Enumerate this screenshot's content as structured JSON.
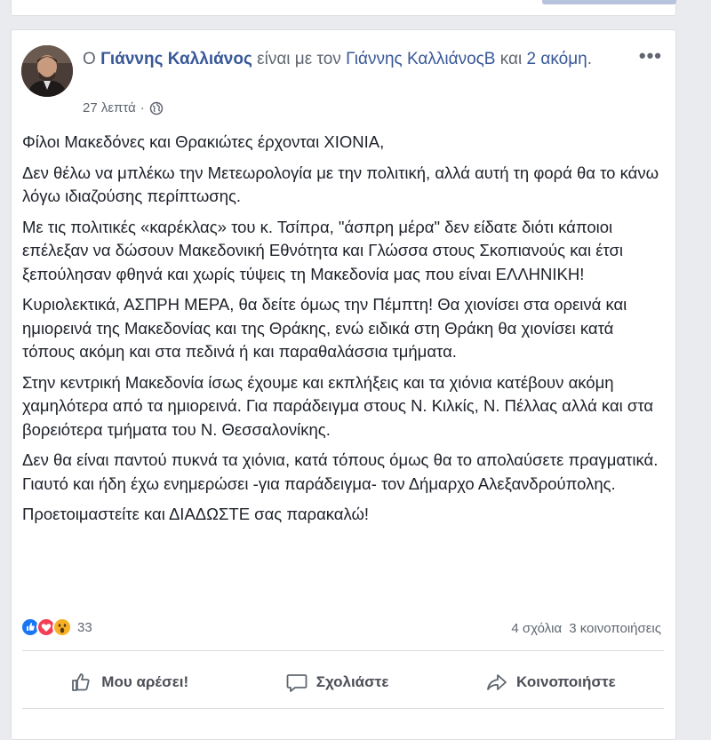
{
  "post": {
    "header": {
      "article": "Ο",
      "author": "Γιάννης Καλλιάνος",
      "with_text": "είναι με τον",
      "tagged": "Γιάννης ΚαλλιάνοςΒ",
      "and_text": "και",
      "others": "2 ακόμη",
      "period": "."
    },
    "timestamp": "27 λεπτά",
    "separator": "·",
    "privacy_icon": "globe-icon",
    "paragraphs": [
      "Φίλοι Μακεδόνες και Θρακιώτες έρχονται ΧΙΟΝΙΑ,",
      "Δεν θέλω να μπλέκω την Μετεωρολογία με την πολιτική, αλλά αυτή τη φορά θα το κάνω λόγω ιδιαζούσης περίπτωσης.",
      "Με τις πολιτικές «καρέκλας» του κ. Τσίπρα, \"άσπρη μέρα\" δεν είδατε διότι κάποιοι επέλεξαν να δώσουν Μακεδονική Εθνότητα και Γλώσσα στους Σκοπιανούς και έτσι ξεπούλησαν φθηνά και χωρίς τύψεις τη Μακεδονία μας που είναι ΕΛΛΗΝΙΚΗ!",
      "Κυριολεκτικά, ΑΣΠΡΗ ΜΕΡΑ, θα δείτε όμως την Πέμπτη! Θα χιονίσει στα ορεινά και ημιορεινά της Μακεδονίας και της Θράκης, ενώ ειδικά στη Θράκη θα χιονίσει κατά τόπους ακόμη και στα πεδινά ή και παραθαλάσσια τμήματα.",
      "Στην κεντρική Μακεδονία ίσως έχουμε και εκπλήξεις και τα χιόνια κατέβουν ακόμη χαμηλότερα από τα ημιορεινά. Για παράδειγμα στους Ν. Κιλκίς, Ν. Πέλλας αλλά και στα βορειότερα τμήματα του Ν. Θεσσαλονίκης.",
      "Δεν θα είναι παντού πυκνά τα χιόνια, κατά τόπους όμως θα το απολαύσετε πραγματικά. Γιαυτό και ήδη έχω ενημερώσει -για παράδειγμα- τον Δήμαρχο Αλεξανδρούπολης.",
      "Προετοιμαστείτε και ΔΙΑΔΩΣΤΕ σας παρακαλώ!"
    ],
    "reactions": {
      "icons": [
        "like-icon",
        "love-icon",
        "wow-icon"
      ],
      "count": "33",
      "comments": "4 σχόλια",
      "shares": "3 κοινοποιήσεις"
    },
    "actions": {
      "like": "Μου αρέσει!",
      "comment": "Σχολιάστε",
      "share": "Κοινοποιήστε"
    },
    "colors": {
      "link": "#385898",
      "like_blue": "#1877f2",
      "love_red": "#f33e58",
      "wow_yellow": "#f7b125"
    }
  }
}
